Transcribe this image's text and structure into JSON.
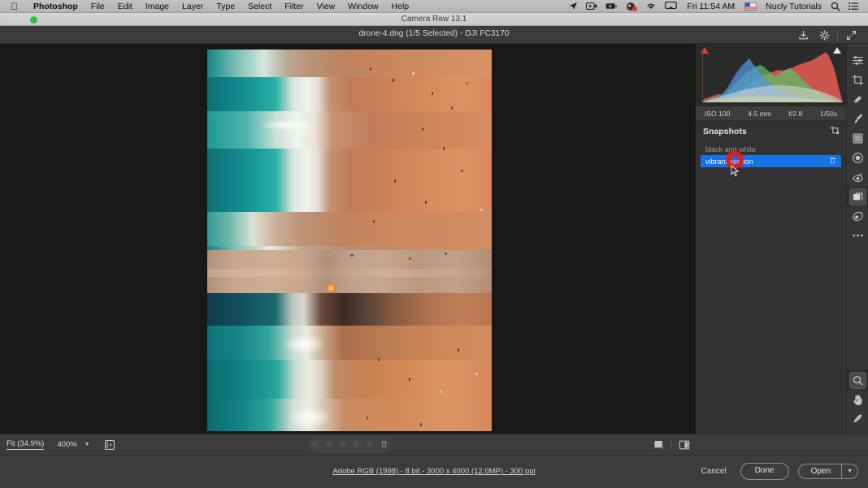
{
  "menubar": {
    "apple_icon": "apple-logo-icon",
    "items": [
      "Photoshop",
      "File",
      "Edit",
      "Image",
      "Layer",
      "Type",
      "Select",
      "Filter",
      "View",
      "Window",
      "Help"
    ],
    "status_icons": [
      "location-arrow-icon",
      "screen-record-icon",
      "battery-icon",
      "app-badge-icon",
      "wifi-icon",
      "airplay-icon"
    ],
    "clock": "Fri 11:54 AM",
    "input_flag_icon": "keyboard-flag-icon",
    "user": "Nucly Tutorials",
    "search_icon": "search-icon",
    "control_center_icon": "control-center-icon"
  },
  "window": {
    "title": "Camera Raw 13.1",
    "traffic_lights": [
      "close",
      "minimize",
      "zoom"
    ]
  },
  "toolbar": {
    "file_title": "drone-4.dng (1/5 Selected)  -  DJI FC3170",
    "save_icon": "save-image-icon",
    "settings_icon": "gear-icon",
    "fullscreen_icon": "expand-arrows-icon"
  },
  "canvas": {
    "image_name": "drone-4.dng",
    "image_alt": "aerial drone photo of a beach with turquoise ocean, white surf, orange sand, pier and umbrellas"
  },
  "histogram": {
    "clip_shadow_icon": "shadow-clipping-warning-icon",
    "clip_highlight_icon": "highlight-clipping-warning-icon",
    "exif": [
      "ISO 100",
      "4.5 mm",
      "f/2.8",
      "1/50s"
    ]
  },
  "snapshots": {
    "title": "Snapshots",
    "expand_icon": "panel-expand-icon",
    "items": [
      {
        "label": "black and white",
        "selected": false
      },
      {
        "label": "vibrant version",
        "selected": true
      }
    ],
    "delete_icon": "trash-icon",
    "selected_color": "#1473e6"
  },
  "tool_rail": {
    "top_tools": [
      {
        "name": "edit-sliders-tool",
        "active": false
      },
      {
        "name": "crop-tool",
        "active": false
      },
      {
        "name": "spot-removal-tool",
        "active": false
      },
      {
        "name": "adjustment-brush-tool",
        "active": false
      },
      {
        "name": "graduated-filter-tool",
        "active": false
      },
      {
        "name": "radial-filter-tool",
        "active": false
      },
      {
        "name": "red-eye-tool",
        "active": false
      },
      {
        "name": "snapshots-tool",
        "active": true
      },
      {
        "name": "presets-tool",
        "active": false
      },
      {
        "name": "more-options-tool",
        "active": false
      }
    ],
    "bottom_tools": [
      {
        "name": "zoom-tool",
        "active": true
      },
      {
        "name": "hand-tool",
        "active": false
      },
      {
        "name": "white-balance-eyedropper-tool",
        "active": false
      },
      {
        "name": "grid-overlay-tool",
        "active": false
      }
    ]
  },
  "bottom_bar": {
    "fit_label": "Fit (34.9%)",
    "zoom_value": "400%",
    "zoom_chevron_icon": "chevron-down-icon",
    "filmstrip_icon": "filmstrip-toggle-icon",
    "rating": {
      "stars": 5,
      "filled": 0,
      "star_icon": "star-outline-icon",
      "reject_icon": "trash-icon"
    },
    "view_modes": [
      {
        "name": "single-view-icon",
        "active": false
      },
      {
        "name": "before-after-split-view-icon",
        "active": false
      }
    ]
  },
  "footer": {
    "workflow_options": "Adobe RGB (1998) - 8 bit - 3000 x 4000 (12.0MP) - 300 ppi",
    "cancel_label": "Cancel",
    "done_label": "Done",
    "open_label": "Open",
    "open_menu_icon": "chevron-down-icon"
  },
  "annotation": {
    "click_marker": "click-highlight-circle",
    "cursor": "mouse-pointer-icon"
  }
}
